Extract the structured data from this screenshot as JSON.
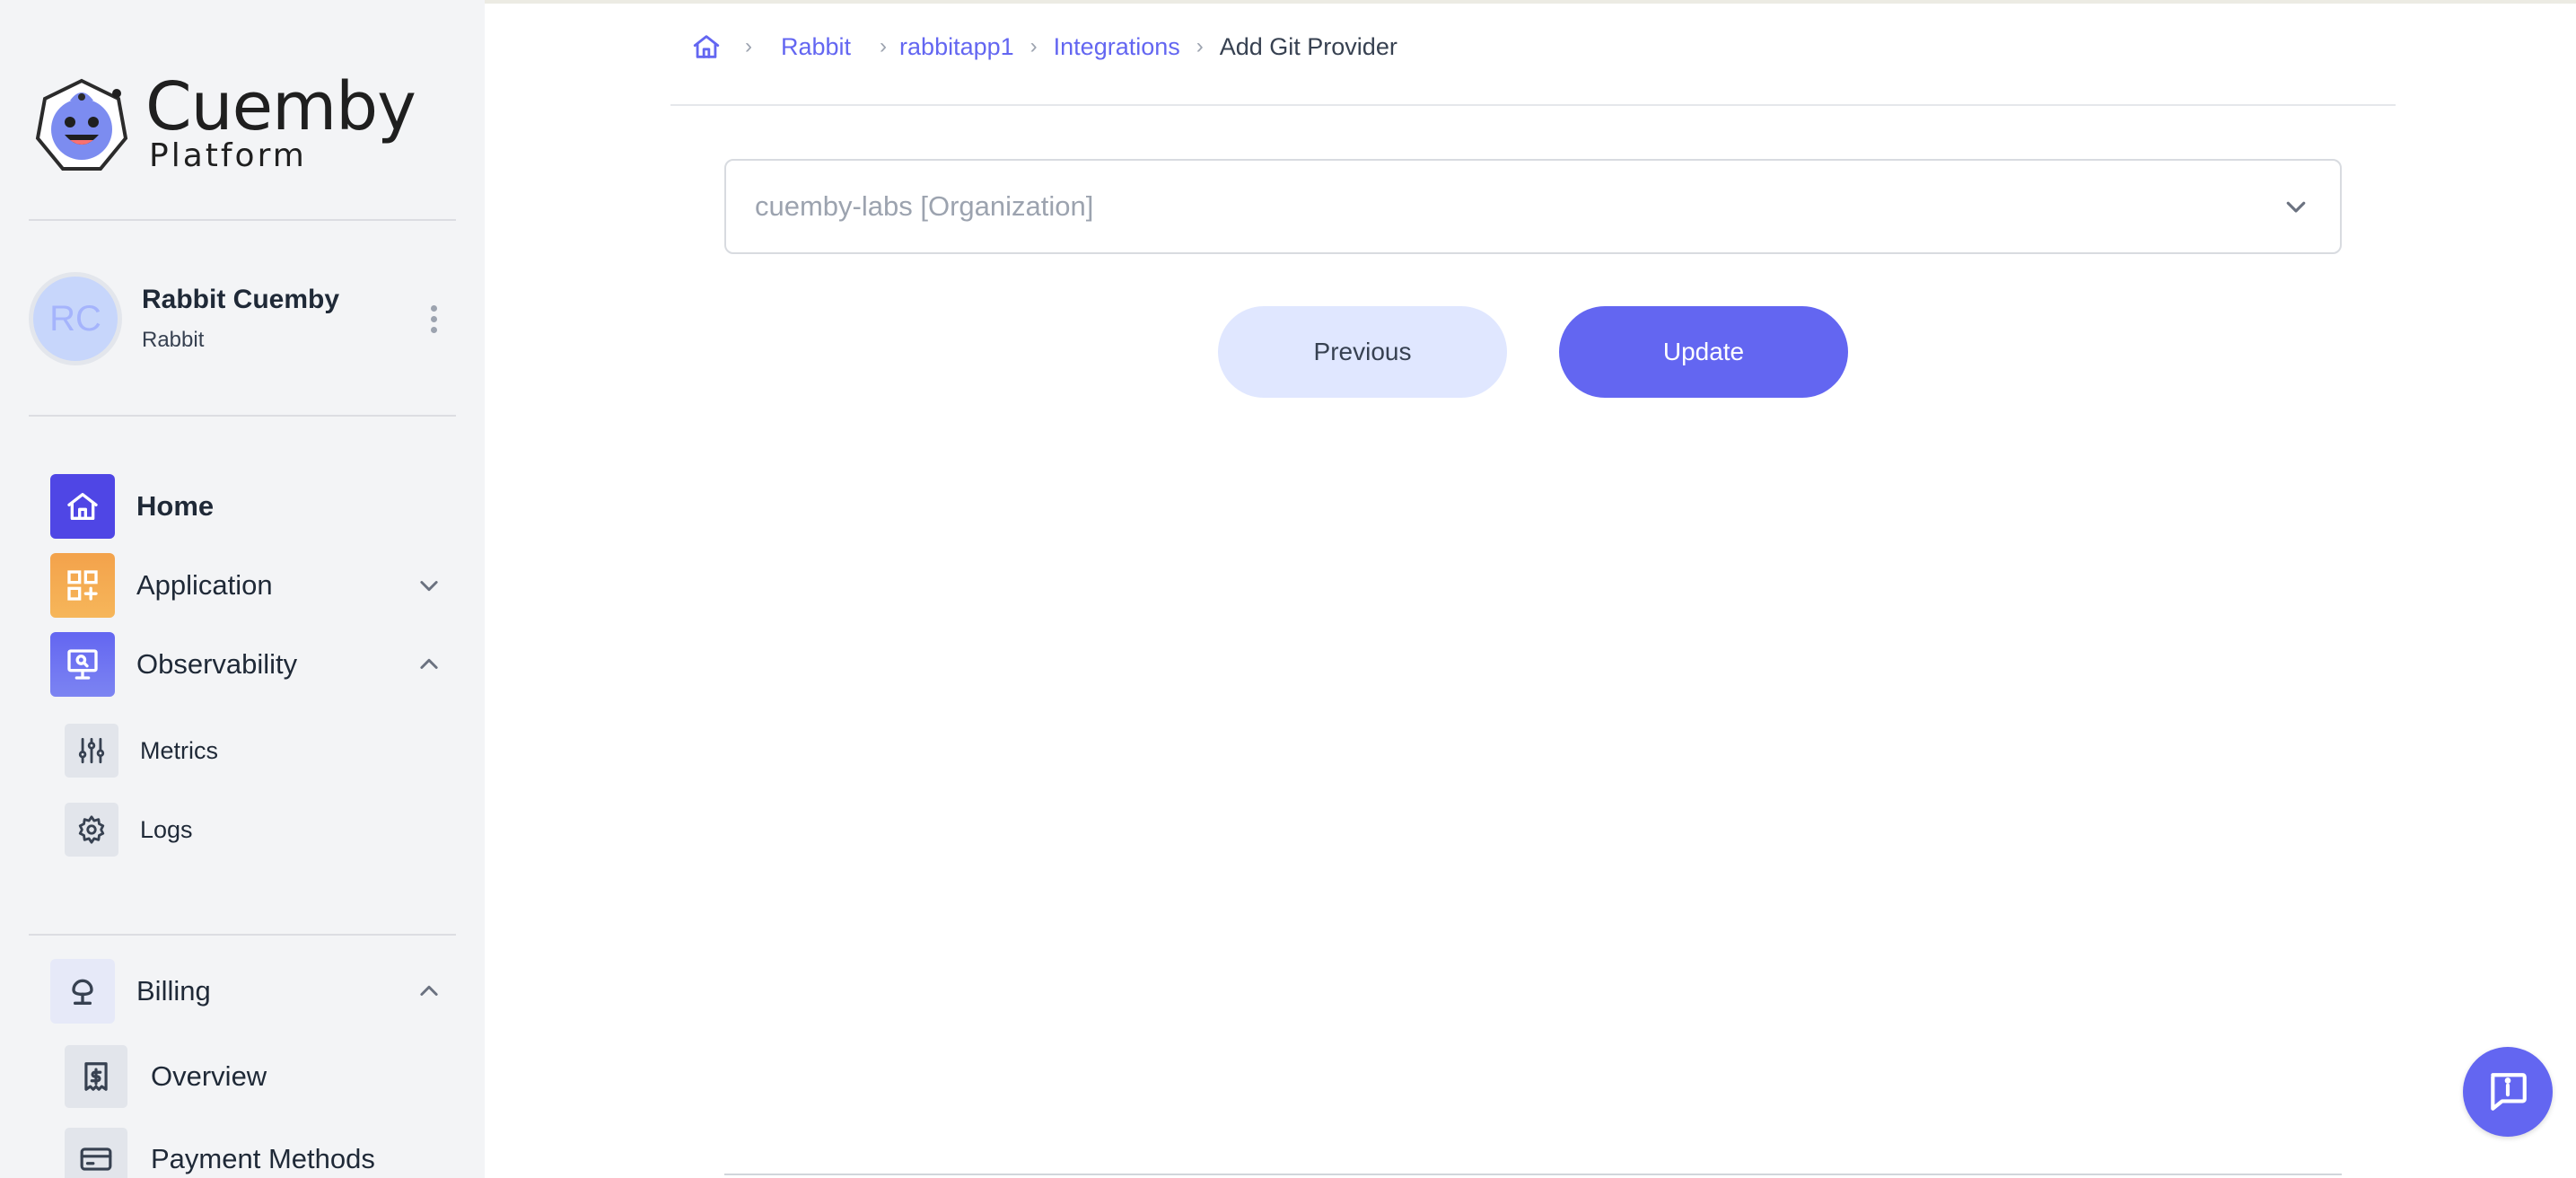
{
  "brand": {
    "name": "Cuemby",
    "subtitle": "Platform"
  },
  "user": {
    "initials": "RC",
    "name": "Rabbit Cuemby",
    "role": "Rabbit"
  },
  "nav": {
    "home": "Home",
    "application": "Application",
    "observability": "Observability",
    "metrics": "Metrics",
    "logs": "Logs",
    "billing": "Billing",
    "overview": "Overview",
    "payment_methods": "Payment Methods"
  },
  "breadcrumb": {
    "items": [
      "Rabbit",
      "rabbitapp1",
      "Integrations"
    ],
    "current": "Add Git Provider"
  },
  "form": {
    "organization_value": "cuemby-labs [Organization]",
    "previous_label": "Previous",
    "update_label": "Update"
  },
  "colors": {
    "accent": "#6366f1",
    "home_icon_bg": "#4f46e5",
    "application_icon_bg": "#f5a64a",
    "observability_icon_bg": "#6f78ef"
  },
  "icons": {
    "home": "home-icon",
    "application": "grid-plus-icon",
    "observability": "monitor-search-icon",
    "metrics": "sliders-icon",
    "logs": "gear-icon",
    "billing": "tree-icon",
    "overview": "receipt-dollar-icon",
    "payment_methods": "credit-card-icon",
    "chat": "chat-info-icon"
  }
}
